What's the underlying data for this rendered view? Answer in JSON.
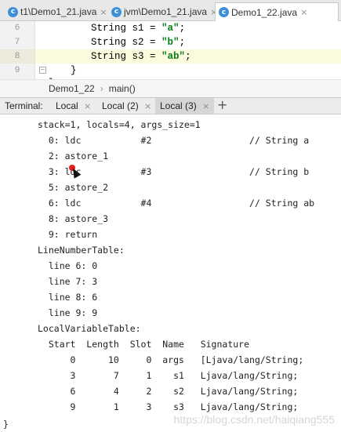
{
  "tabs": [
    {
      "label": "t1\\Demo1_21.java",
      "icon": "java-class-icon",
      "icon_letter": "c"
    },
    {
      "label": "jvm\\Demo1_21.java",
      "icon": "java-class-icon",
      "icon_letter": "c"
    },
    {
      "label": "Demo1_22.java",
      "icon": "java-class-icon",
      "icon_letter": "c"
    }
  ],
  "close_glyph": "×",
  "editor": {
    "line_numbers": [
      "6",
      "7",
      "8",
      "9",
      ""
    ],
    "lines": [
      {
        "kw": "String ",
        "name": "s1",
        "eq": " = ",
        "val": "\"a\"",
        "end": ";"
      },
      {
        "kw": "String ",
        "name": "s2",
        "eq": " = ",
        "val": "\"b\"",
        "end": ";"
      },
      {
        "kw": "String ",
        "name": "s3",
        "eq": " = ",
        "val": "\"ab\"",
        "end": ";"
      }
    ],
    "closing_brace": "}",
    "closing_brace_2": "}"
  },
  "breadcrumb": {
    "class": "Demo1_22",
    "sep": "›",
    "method": "main()"
  },
  "terminal": {
    "label": "Terminal:",
    "tabs": [
      "Local",
      "Local (2)",
      "Local (3)"
    ],
    "add": "+",
    "lines": [
      "stack=1, locals=4, args_size=1",
      "  0: ldc           #2                  // String a",
      "  2: astore_1",
      "  3: ldc           #3                  // String b",
      "  5: astore_2",
      "  6: ldc           #4                  // String ab",
      "  8: astore_3",
      "  9: return",
      "LineNumberTable:",
      "  line 6: 0",
      "  line 7: 3",
      "  line 8: 6",
      "  line 9: 9",
      "LocalVariableTable:",
      "  Start  Length  Slot  Name   Signature",
      "      0      10     0  args   [Ljava/lang/String;",
      "      3       7     1    s1   Ljava/lang/String;",
      "      6       4     2    s2   Ljava/lang/String;",
      "      9       1     3    s3   Ljava/lang/String;"
    ],
    "final_brace": "}"
  },
  "watermark": "https://blog.csdn.net/haiqiang555"
}
